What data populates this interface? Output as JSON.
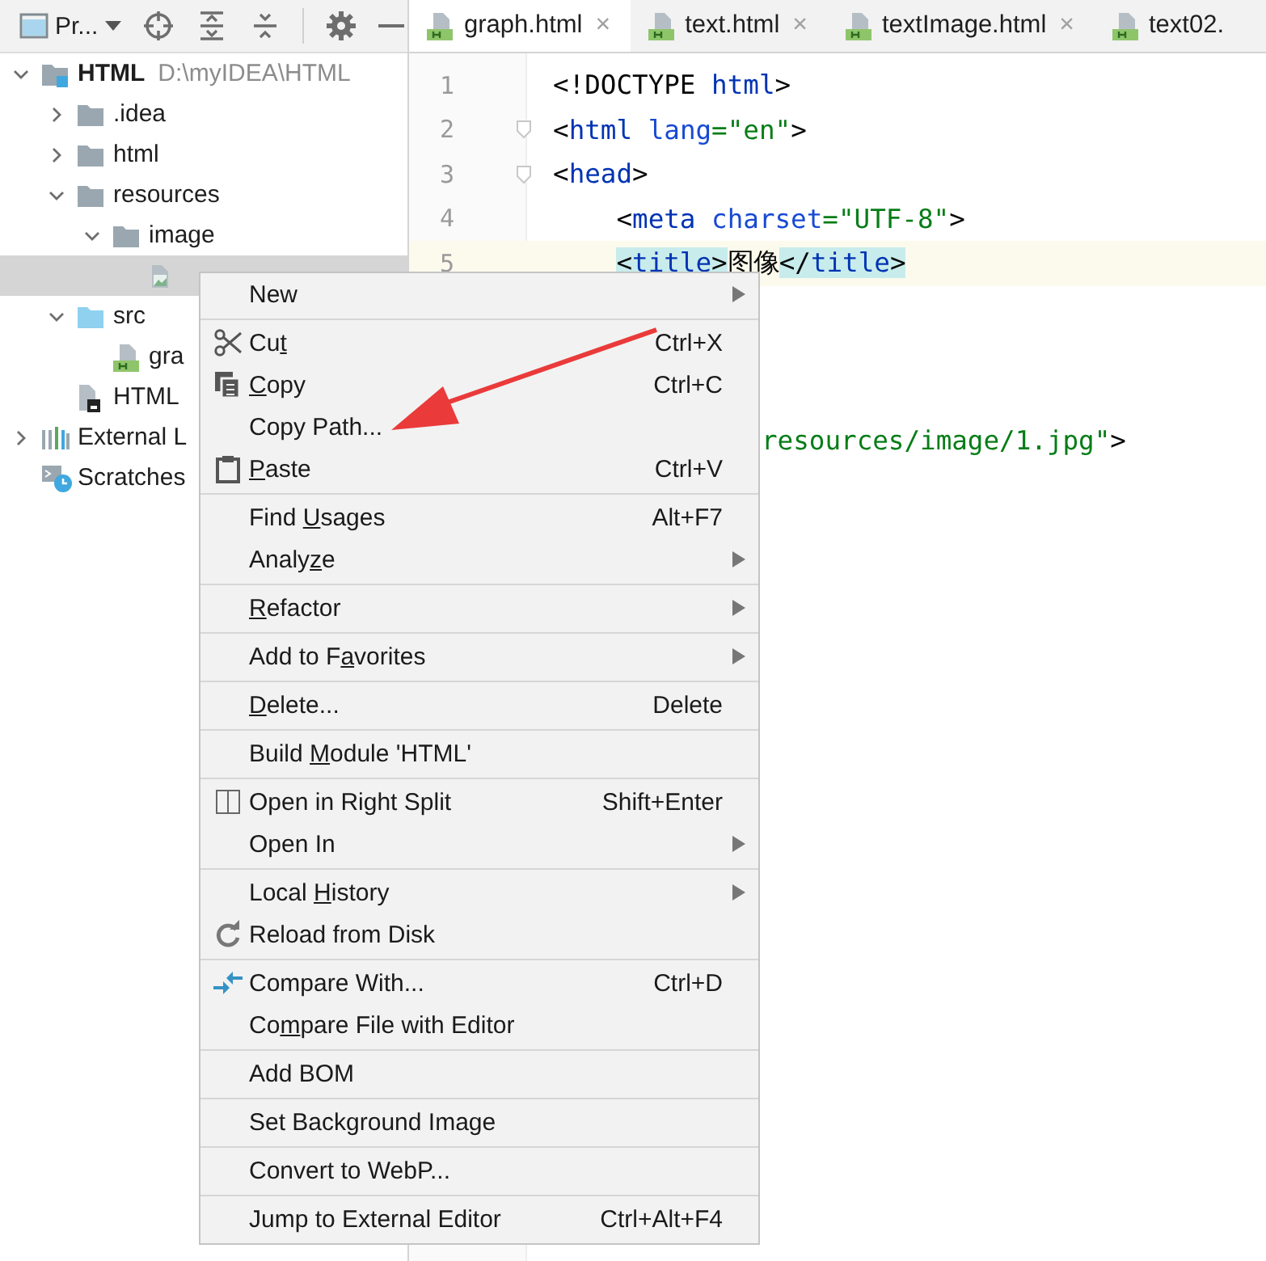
{
  "project_panel": {
    "title": "Pr...",
    "buttons": [
      {
        "kind": "locate"
      },
      {
        "kind": "expand-all"
      },
      {
        "kind": "collapse-all"
      },
      {
        "kind": "settings"
      },
      {
        "kind": "hide"
      }
    ]
  },
  "project_tree": {
    "items": [
      {
        "label": "HTML",
        "path": "D:\\myIDEA\\HTML",
        "kind": "module",
        "expanded": true,
        "selected": false,
        "children": [
          {
            "label": ".idea",
            "kind": "folder",
            "expanded": false,
            "selected": false
          },
          {
            "label": "html",
            "kind": "folder",
            "expanded": false,
            "selected": false
          },
          {
            "label": "resources",
            "kind": "folder",
            "expanded": true,
            "selected": false,
            "children": [
              {
                "label": "image",
                "kind": "folder",
                "expanded": true,
                "selected": false,
                "children": [
                  {
                    "kind": "image-file",
                    "selected": true
                  }
                ]
              }
            ]
          },
          {
            "label": "src",
            "kind": "source-folder",
            "expanded": true,
            "selected": false,
            "children": [
              {
                "label": "gra",
                "kind": "html-file",
                "selected": false
              }
            ]
          },
          {
            "label": "HTML",
            "kind": "iml-file",
            "selected": false
          }
        ]
      },
      {
        "label": "External L",
        "kind": "library",
        "expanded": false,
        "selected": false
      },
      {
        "label": "Scratches",
        "kind": "scratches",
        "selected": false
      }
    ]
  },
  "editor": {
    "tabs": [
      {
        "label": "graph.html",
        "selected": true,
        "closable": true
      },
      {
        "label": "text.html",
        "selected": false,
        "closable": true
      },
      {
        "label": "textImage.html",
        "selected": false,
        "closable": true
      },
      {
        "label": "text02.",
        "selected": false,
        "closable": false
      }
    ],
    "close_glyph": "×",
    "lines": [
      {
        "number": "1",
        "current": false,
        "fold": false,
        "indented": false,
        "tokens": [
          {
            "text": "<!DOCTYPE ",
            "kind": "plain",
            "matched": false
          },
          {
            "text": "html",
            "kind": "tag",
            "matched": false
          },
          {
            "text": ">",
            "kind": "plain",
            "matched": false
          }
        ]
      },
      {
        "number": "2",
        "current": false,
        "fold": true,
        "indented": false,
        "tokens": [
          {
            "text": "<",
            "kind": "plain",
            "matched": false
          },
          {
            "text": "html",
            "kind": "tag",
            "matched": false
          },
          {
            "text": " lang",
            "kind": "attr",
            "matched": false
          },
          {
            "text": "=\"en\"",
            "kind": "value",
            "matched": false
          },
          {
            "text": ">",
            "kind": "plain",
            "matched": false
          }
        ]
      },
      {
        "number": "3",
        "current": false,
        "fold": true,
        "indented": false,
        "tokens": [
          {
            "text": "<",
            "kind": "plain",
            "matched": false
          },
          {
            "text": "head",
            "kind": "tag",
            "matched": false
          },
          {
            "text": ">",
            "kind": "plain",
            "matched": false
          }
        ]
      },
      {
        "number": "4",
        "current": false,
        "fold": false,
        "indented": true,
        "tokens": [
          {
            "text": "<",
            "kind": "plain",
            "matched": false
          },
          {
            "text": "meta",
            "kind": "tag",
            "matched": false
          },
          {
            "text": " charset",
            "kind": "attr",
            "matched": false
          },
          {
            "text": "=\"UTF-8\"",
            "kind": "value",
            "matched": false
          },
          {
            "text": ">",
            "kind": "plain",
            "matched": false
          }
        ]
      },
      {
        "number": "5",
        "current": true,
        "fold": false,
        "indented": true,
        "tokens": [
          {
            "text": "<",
            "kind": "plain",
            "matched": true
          },
          {
            "text": "title",
            "kind": "tag",
            "matched": true
          },
          {
            "text": ">",
            "kind": "plain",
            "matched": true
          },
          {
            "text": "图像",
            "kind": "plain",
            "matched": false
          },
          {
            "text": "</",
            "kind": "plain",
            "matched": true
          },
          {
            "text": "title",
            "kind": "tag",
            "matched": true
          },
          {
            "text": ">",
            "kind": "plain",
            "matched": true
          }
        ]
      }
    ],
    "partly_hidden_line": {
      "tokens": [
        {
          "text": "resources/image/1.jpg\"",
          "kind": "value",
          "matched": false
        },
        {
          "text": ">",
          "kind": "plain",
          "matched": false
        }
      ]
    }
  },
  "context_menu": {
    "sections": [
      [
        {
          "label": [
            {
              "text": "New",
              "underlined": false
            }
          ],
          "submenu": true
        }
      ],
      [
        {
          "label": [
            {
              "text": "Cu",
              "underlined": false
            },
            {
              "text": "t",
              "underlined": true
            }
          ],
          "kind": "cut",
          "shortcut": "Ctrl+X",
          "submenu": false
        },
        {
          "label": [
            {
              "text": "C",
              "underlined": true
            },
            {
              "text": "opy",
              "underlined": false
            }
          ],
          "kind": "copy",
          "shortcut": "Ctrl+C",
          "submenu": false
        },
        {
          "label": [
            {
              "text": "Copy Path...",
              "underlined": false
            }
          ],
          "submenu": false
        },
        {
          "label": [
            {
              "text": "P",
              "underlined": true
            },
            {
              "text": "aste",
              "underlined": false
            }
          ],
          "kind": "paste",
          "shortcut": "Ctrl+V",
          "submenu": false
        }
      ],
      [
        {
          "label": [
            {
              "text": "Find ",
              "underlined": false
            },
            {
              "text": "U",
              "underlined": true
            },
            {
              "text": "sages",
              "underlined": false
            }
          ],
          "shortcut": "Alt+F7",
          "submenu": false
        },
        {
          "label": [
            {
              "text": "Analy",
              "underlined": false
            },
            {
              "text": "z",
              "underlined": true
            },
            {
              "text": "e",
              "underlined": false
            }
          ],
          "submenu": true
        }
      ],
      [
        {
          "label": [
            {
              "text": "R",
              "underlined": true
            },
            {
              "text": "efactor",
              "underlined": false
            }
          ],
          "submenu": true
        }
      ],
      [
        {
          "label": [
            {
              "text": "Add to F",
              "underlined": false
            },
            {
              "text": "a",
              "underlined": true
            },
            {
              "text": "vorites",
              "underlined": false
            }
          ],
          "submenu": true
        }
      ],
      [
        {
          "label": [
            {
              "text": "D",
              "underlined": true
            },
            {
              "text": "elete...",
              "underlined": false
            }
          ],
          "shortcut": "Delete",
          "submenu": false
        }
      ],
      [
        {
          "label": [
            {
              "text": "Build ",
              "underlined": false
            },
            {
              "text": "M",
              "underlined": true
            },
            {
              "text": "odule 'HTML'",
              "underlined": false
            }
          ],
          "submenu": false
        }
      ],
      [
        {
          "label": [
            {
              "text": "Open in Right Split",
              "underlined": false
            }
          ],
          "kind": "split",
          "shortcut": "Shift+Enter",
          "submenu": false
        },
        {
          "label": [
            {
              "text": "Open In",
              "underlined": false
            }
          ],
          "submenu": true
        }
      ],
      [
        {
          "label": [
            {
              "text": "Local ",
              "underlined": false
            },
            {
              "text": "H",
              "underlined": true
            },
            {
              "text": "istory",
              "underlined": false
            }
          ],
          "submenu": true
        },
        {
          "label": [
            {
              "text": "Reload from Disk",
              "underlined": false
            }
          ],
          "kind": "reload",
          "submenu": false
        }
      ],
      [
        {
          "label": [
            {
              "text": "Compare With...",
              "underlined": false
            }
          ],
          "kind": "compare",
          "shortcut": "Ctrl+D",
          "submenu": false
        },
        {
          "label": [
            {
              "text": "Co",
              "underlined": false
            },
            {
              "text": "m",
              "underlined": true
            },
            {
              "text": "pare File with Editor",
              "underlined": false
            }
          ],
          "submenu": false
        }
      ],
      [
        {
          "label": [
            {
              "text": "Add BOM",
              "underlined": false
            }
          ],
          "submenu": false
        }
      ],
      [
        {
          "label": [
            {
              "text": "Set Background Image",
              "underlined": false
            }
          ],
          "submenu": false
        }
      ],
      [
        {
          "label": [
            {
              "text": "Convert to WebP...",
              "underlined": false
            }
          ],
          "submenu": false
        }
      ],
      [
        {
          "label": [
            {
              "text": "Jump to External Editor",
              "underlined": false
            }
          ],
          "shortcut": "Ctrl+Alt+F4",
          "submenu": false
        }
      ]
    ]
  }
}
